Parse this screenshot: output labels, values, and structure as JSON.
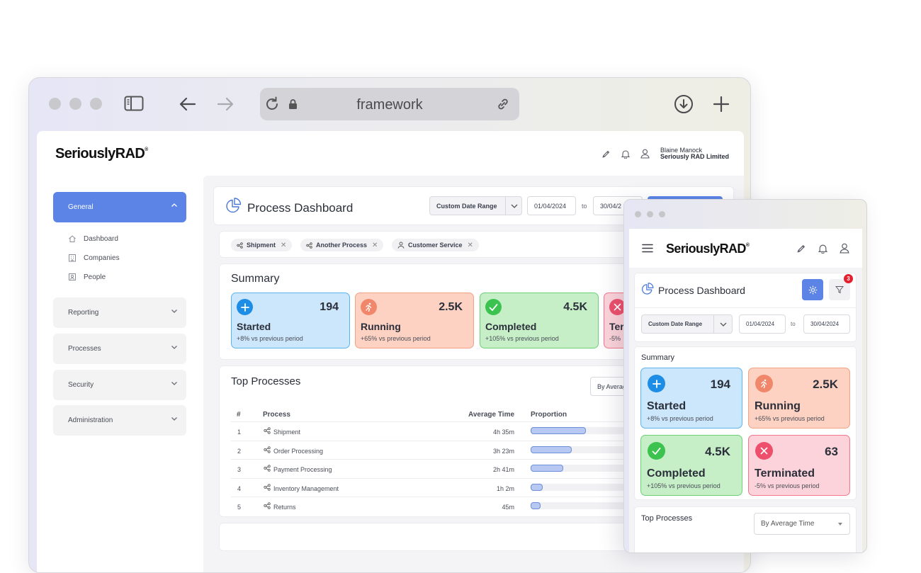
{
  "browser": {
    "url": "framework"
  },
  "app": {
    "logo": "SeriouslyRAD",
    "logo_mark": "®",
    "user": {
      "name": "Blaine Manock",
      "company": "Seriously RAD Limited"
    }
  },
  "sidebar": {
    "groups": [
      {
        "label": "General",
        "expanded": true,
        "items": [
          {
            "label": "Dashboard"
          },
          {
            "label": "Companies"
          },
          {
            "label": "People"
          }
        ]
      },
      {
        "label": "Reporting"
      },
      {
        "label": "Processes"
      },
      {
        "label": "Security"
      },
      {
        "label": "Administration"
      }
    ]
  },
  "dashboard": {
    "title": "Process Dashboard",
    "date_range_label": "Custom Date Range",
    "date_from": "01/04/2024",
    "to_label": "to",
    "date_to": "30/04/2024",
    "date_to_partial": "30/04/2",
    "filters": [
      "Shipment",
      "Another Process",
      "Customer Service"
    ],
    "filter_count": "3",
    "summary_title": "Summary",
    "stats": [
      {
        "value": "194",
        "label": "Started",
        "change": "+8% vs previous period"
      },
      {
        "value": "2.5K",
        "label": "Running",
        "change": "+65% vs previous period"
      },
      {
        "value": "4.5K",
        "label": "Completed",
        "change": "+105% vs previous period"
      },
      {
        "value": "63",
        "label": "Terminated",
        "change": "-5% vs previous period",
        "label_partial": "Ter",
        "change_partial": "-5%"
      }
    ],
    "top_processes": {
      "title": "Top Processes",
      "sort_label": "By Average Time",
      "sort_partial": "By Averag",
      "columns": [
        "#",
        "Process",
        "Average Time",
        "Proportion"
      ],
      "rows": [
        {
          "rank": "1",
          "name": "Shipment",
          "time": "4h 35m",
          "proportion": 0.46
        },
        {
          "rank": "2",
          "name": "Order Processing",
          "time": "3h 23m",
          "proportion": 0.34
        },
        {
          "rank": "3",
          "name": "Payment Processing",
          "time": "2h 41m",
          "proportion": 0.27
        },
        {
          "rank": "4",
          "name": "Inventory Management",
          "time": "1h 2m",
          "proportion": 0.1
        },
        {
          "rank": "5",
          "name": "Returns",
          "time": "45m",
          "proportion": 0.07
        }
      ]
    }
  },
  "colors": {
    "accent": "#5b84e6",
    "started": "#1e8de6",
    "running": "#f1876a",
    "completed": "#3cc24e",
    "terminated": "#ee4f6c",
    "badge": "#e5202e"
  }
}
